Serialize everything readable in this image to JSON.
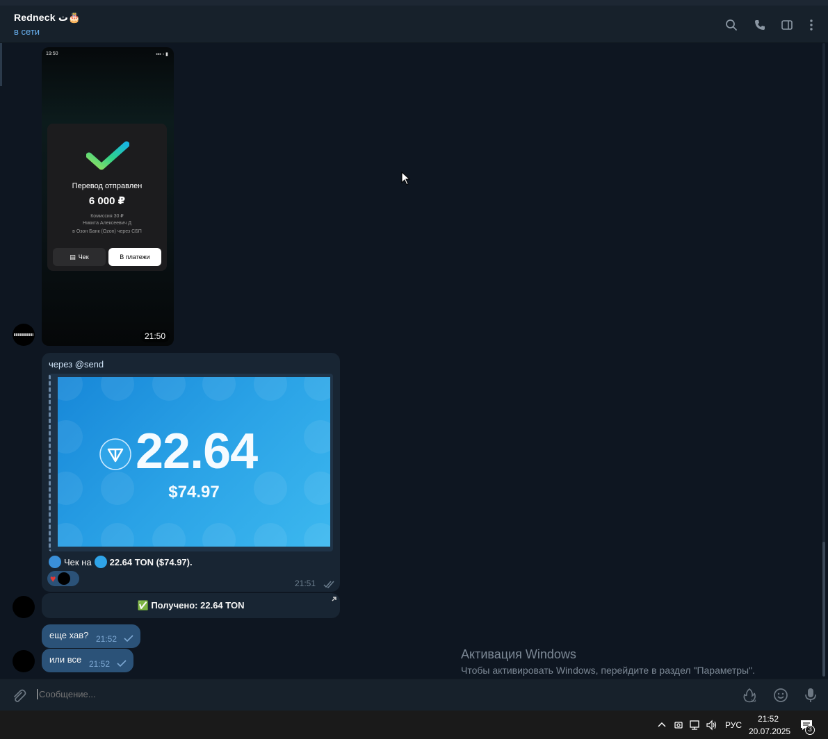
{
  "header": {
    "chat_name": "Redneck ت🎂",
    "status": "в сети"
  },
  "photo_message": {
    "phone_time": "19:50",
    "card_title": "Перевод отправлен",
    "card_amount": "6 000 ₽",
    "card_lines": [
      "Комиссия 30 ₽",
      "Никита Алексеевич Д",
      "в Озон Банк (Ozon) через СБП"
    ],
    "btn_receipt": "Чек",
    "btn_payments": "В платежи",
    "time": "21:50"
  },
  "send_message": {
    "via": "через @send",
    "ton_amount": "22.64",
    "usd_amount": "$74.97",
    "check_prefix": "Чек на",
    "check_amount": "22.64 TON ($74.97).",
    "time": "21:51",
    "received_label": "✅ Получено: 22.64 TON"
  },
  "replies": [
    {
      "text": "еще хав?",
      "time": "21:52"
    },
    {
      "text": "или все",
      "time": "21:52"
    }
  ],
  "watermark": {
    "title": "Активация Windows",
    "subtitle": "Чтобы активировать Windows, перейдите в раздел \"Параметры\"."
  },
  "composer": {
    "placeholder": "Сообщение..."
  },
  "taskbar": {
    "language": "РУС",
    "time": "21:52",
    "date": "20.07.2025",
    "notifications": "3"
  },
  "colors": {
    "accent": "#6ab3f3",
    "bubble_out": "#2b5278",
    "bubble_in": "#182533"
  }
}
